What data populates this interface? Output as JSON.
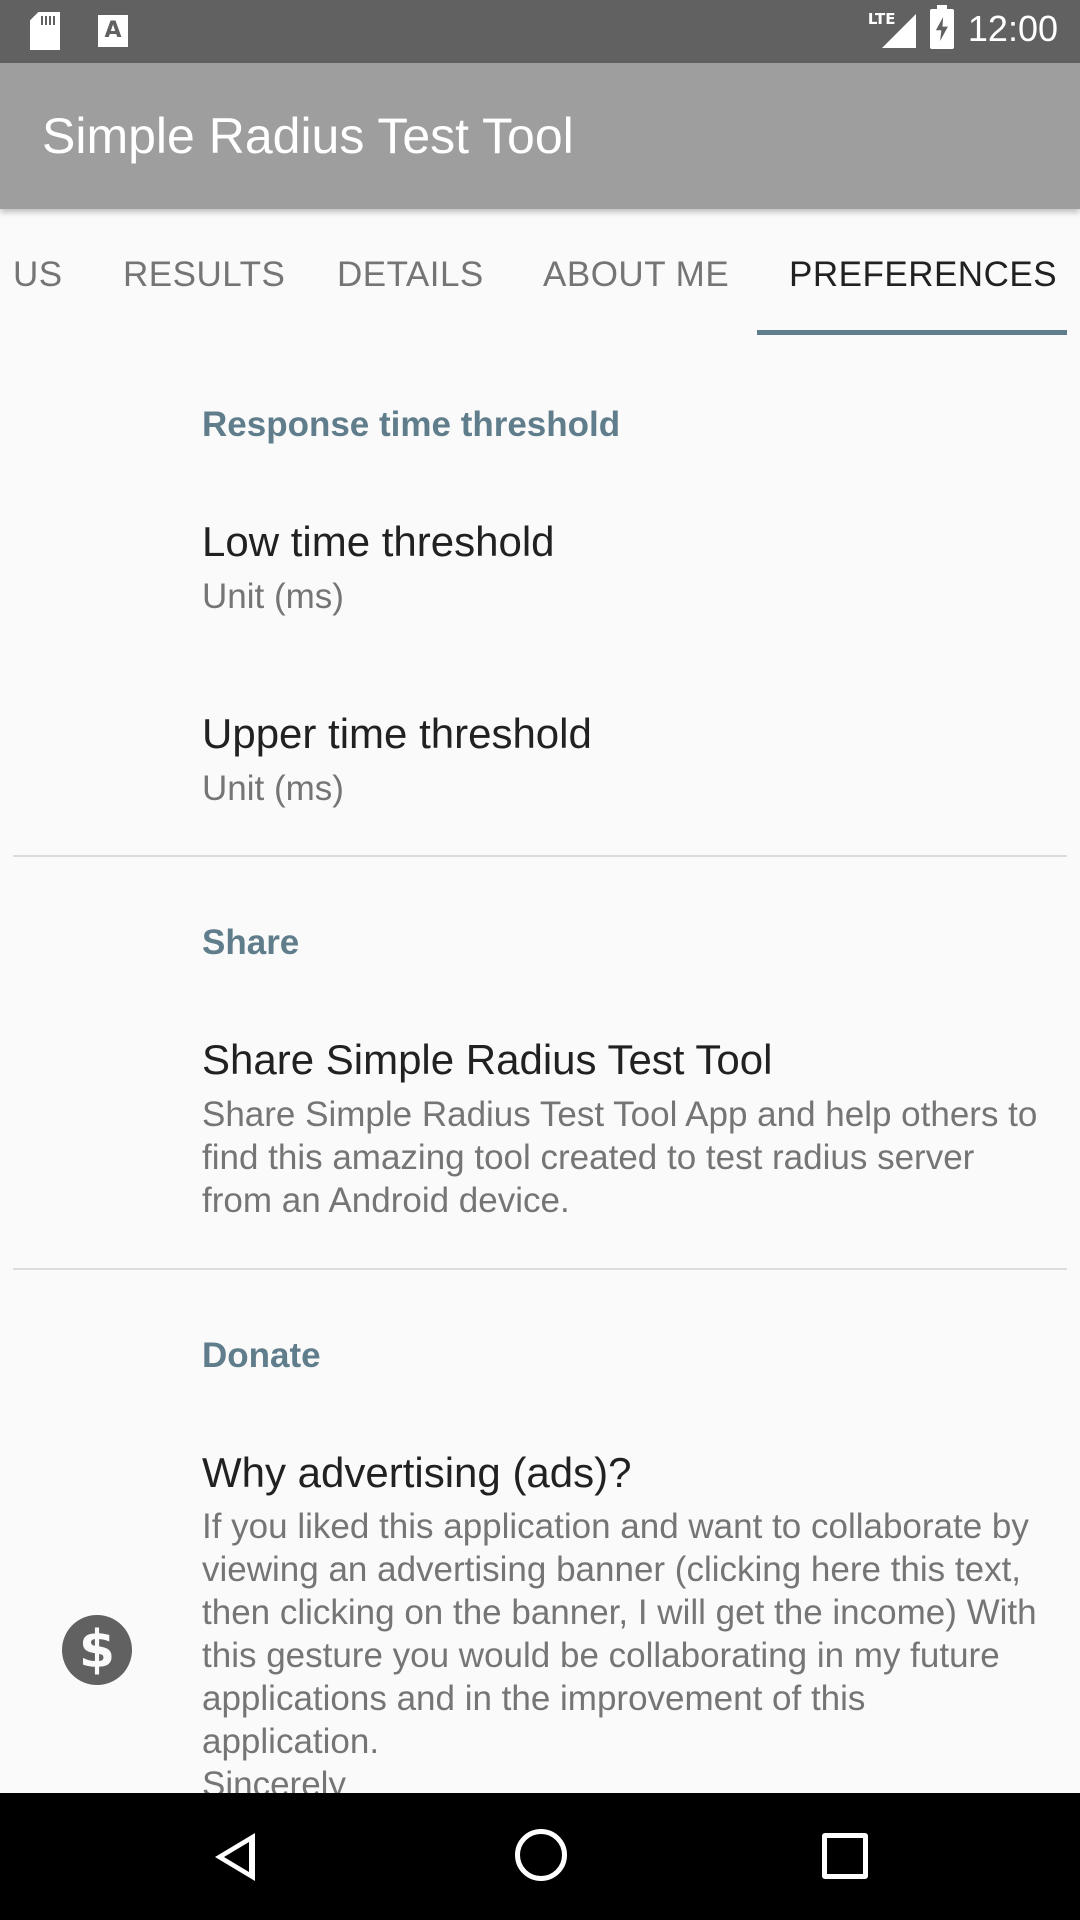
{
  "status_bar": {
    "time": "12:00",
    "network": "LTE",
    "icons": [
      "sd-card-icon",
      "a-notification-icon",
      "lte-signal-icon",
      "battery-charging-icon"
    ]
  },
  "app_bar": {
    "title": "Simple Radius Test Tool"
  },
  "tabs": [
    {
      "label": "US",
      "active": false
    },
    {
      "label": "RESULTS",
      "active": false
    },
    {
      "label": "DETAILS",
      "active": false
    },
    {
      "label": "ABOUT ME",
      "active": false
    },
    {
      "label": "PREFERENCES",
      "active": true
    }
  ],
  "preferences": {
    "response_category": "Response time threshold",
    "low_threshold": {
      "title": "Low time threshold",
      "summary": "Unit (ms)"
    },
    "upper_threshold": {
      "title": "Upper time threshold",
      "summary": "Unit (ms)"
    },
    "share_category": "Share",
    "share": {
      "title": "Share Simple Radius Test Tool",
      "summary": "Share Simple Radius Test Tool App and help others to find this amazing tool created to test radius server from an Android device."
    },
    "donate_category": "Donate",
    "ads": {
      "title": "Why advertising (ads)?",
      "summary": "If you liked this application and want to collaborate by viewing an advertising banner (clicking here this text, then clicking on the banner, I will get the income) With this gesture you would be collaborating in my future applications and in the improvement of this application.",
      "summary_tail": "Sincerely",
      "icon": "dollar-icon",
      "icon_glyph": "$"
    }
  },
  "colors": {
    "status_bar": "#616161",
    "app_bar": "#9e9e9e",
    "accent": "#607d8b",
    "background": "#fafafa"
  }
}
